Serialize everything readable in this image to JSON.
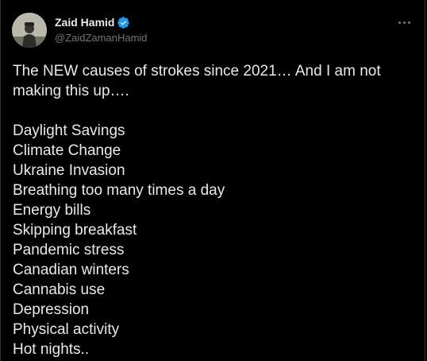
{
  "tweet": {
    "author": {
      "display_name": "Zaid Hamid",
      "handle": "@ZaidZamanHamid",
      "verified": true
    },
    "intro": "The NEW causes of strokes since 2021… And I am not making this up….",
    "causes": [
      "Daylight Savings",
      "Climate Change",
      "Ukraine Invasion",
      "Breathing too many times a day",
      "Energy bills",
      "Skipping breakfast",
      "Pandemic stress",
      "Canadian winters",
      "Cannabis use",
      "Depression",
      "Physical activity",
      "Hot nights.."
    ]
  },
  "icons": {
    "verified": "verified-badge-icon",
    "more": "more-options-icon"
  },
  "colors": {
    "background": "#000000",
    "text": "#e7e9ea",
    "secondary_text": "#71767b",
    "verified_badge": "#1d9bf0"
  }
}
